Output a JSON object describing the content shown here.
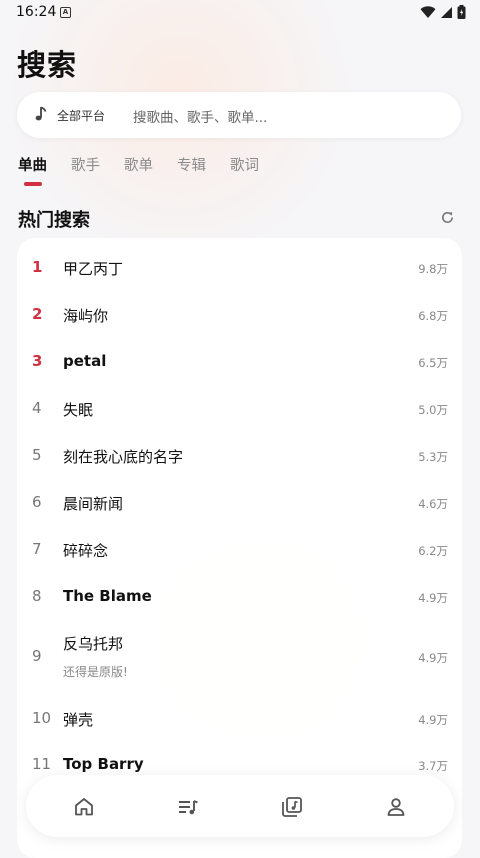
{
  "status_bar": {
    "time": "16:24"
  },
  "page": {
    "title": "搜索"
  },
  "search": {
    "platform": "全部平台",
    "placeholder": "搜歌曲、歌手、歌单..."
  },
  "tabs": [
    {
      "label": "单曲",
      "active": true
    },
    {
      "label": "歌手"
    },
    {
      "label": "歌单"
    },
    {
      "label": "专辑"
    },
    {
      "label": "歌词"
    }
  ],
  "hot": {
    "title": "热门搜索",
    "items": [
      {
        "rank": "1",
        "name": "甲乙丙丁",
        "count": "9.8万"
      },
      {
        "rank": "2",
        "name": "海屿你",
        "count": "6.8万"
      },
      {
        "rank": "3",
        "name": "petal",
        "count": "6.5万"
      },
      {
        "rank": "4",
        "name": "失眠",
        "count": "5.0万"
      },
      {
        "rank": "5",
        "name": "刻在我心底的名字",
        "count": "5.3万"
      },
      {
        "rank": "6",
        "name": "晨间新闻",
        "count": "4.6万"
      },
      {
        "rank": "7",
        "name": "碎碎念",
        "count": "6.2万"
      },
      {
        "rank": "8",
        "name": "The Blame",
        "count": "4.9万"
      },
      {
        "rank": "9",
        "name": "反乌托邦",
        "sub": "还得是原版!",
        "count": "4.9万"
      },
      {
        "rank": "10",
        "name": "弹壳",
        "count": "4.9万"
      },
      {
        "rank": "11",
        "name": "Top Barry",
        "count": "3.7万"
      }
    ]
  },
  "nav": {
    "icons": [
      "home-icon",
      "playlist-icon",
      "music-library-icon",
      "profile-icon"
    ]
  },
  "accent_color": "#d0303f"
}
